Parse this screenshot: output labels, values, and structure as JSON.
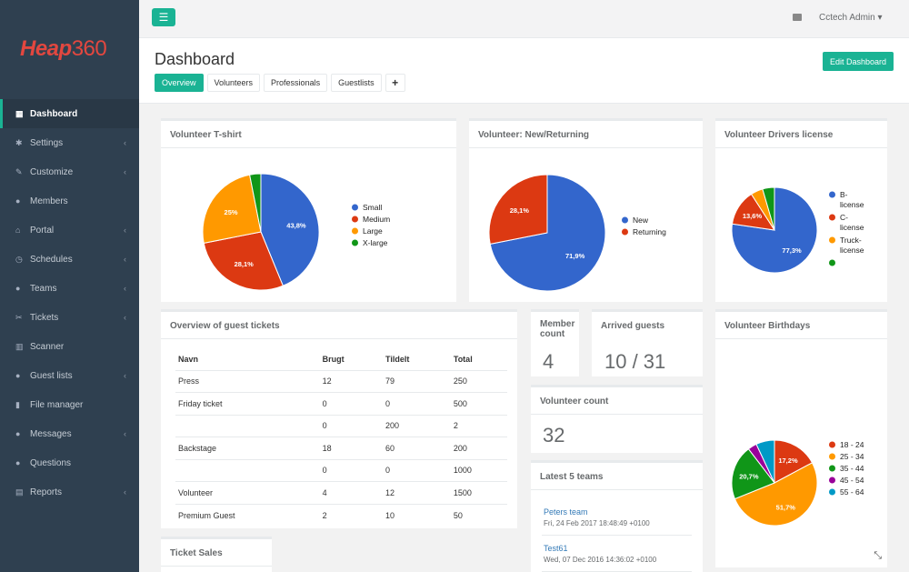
{
  "brand": {
    "logo_text": "Heap",
    "logo_num": "360"
  },
  "sidebar": {
    "items": [
      {
        "label": "Dashboard",
        "icon": "calendar-icon",
        "glyph": "▦",
        "chevron": false
      },
      {
        "label": "Settings",
        "icon": "cogs-icon",
        "glyph": "✱",
        "chevron": true
      },
      {
        "label": "Customize",
        "icon": "brush-icon",
        "glyph": "✎",
        "chevron": true
      },
      {
        "label": "Members",
        "icon": "user-icon",
        "glyph": "●",
        "chevron": false
      },
      {
        "label": "Portal",
        "icon": "home-icon",
        "glyph": "⌂",
        "chevron": true
      },
      {
        "label": "Schedules",
        "icon": "clock-icon",
        "glyph": "◷",
        "chevron": true
      },
      {
        "label": "Teams",
        "icon": "users-icon",
        "glyph": "●",
        "chevron": true
      },
      {
        "label": "Tickets",
        "icon": "ticket-icon",
        "glyph": "✂",
        "chevron": true
      },
      {
        "label": "Scanner",
        "icon": "barcode-icon",
        "glyph": "▥",
        "chevron": false
      },
      {
        "label": "Guest lists",
        "icon": "user-plus-icon",
        "glyph": "●",
        "chevron": true
      },
      {
        "label": "File manager",
        "icon": "file-icon",
        "glyph": "▮",
        "chevron": false
      },
      {
        "label": "Messages",
        "icon": "comments-icon",
        "glyph": "●",
        "chevron": true
      },
      {
        "label": "Questions",
        "icon": "user-plus-icon",
        "glyph": "●",
        "chevron": false
      },
      {
        "label": "Reports",
        "icon": "table-icon",
        "glyph": "▤",
        "chevron": true
      }
    ]
  },
  "topbar": {
    "menu_glyph": "☰",
    "user": "Cctech Admin ▾"
  },
  "header": {
    "title": "Dashboard",
    "tabs": [
      "Overview",
      "Volunteers",
      "Professionals",
      "Guestlists"
    ],
    "plus": "+",
    "edit_button": "Edit Dashboard"
  },
  "panels": {
    "tshirt": {
      "title": "Volunteer T-shirt"
    },
    "newret": {
      "title": "Volunteer: New/Returning"
    },
    "license": {
      "title": "Volunteer Drivers license"
    },
    "guest_tickets": {
      "title": "Overview of guest tickets",
      "columns": [
        "Navn",
        "Brugt",
        "Tildelt",
        "Total"
      ],
      "rows": [
        [
          "Press",
          "12",
          "79",
          "250"
        ],
        [
          "Friday ticket",
          "0",
          "0",
          "500"
        ],
        [
          "",
          "0",
          "200",
          "2"
        ],
        [
          "Backstage",
          "18",
          "60",
          "200"
        ],
        [
          "",
          "0",
          "0",
          "1000"
        ],
        [
          "Volunteer",
          "4",
          "12",
          "1500"
        ],
        [
          "Premium Guest",
          "2",
          "10",
          "50"
        ]
      ]
    },
    "member_count": {
      "title": "Member count",
      "value": "4"
    },
    "arrived": {
      "title": "Arrived guests",
      "value": "10 / 31"
    },
    "volunteer_count": {
      "title": "Volunteer count",
      "value": "32"
    },
    "teams": {
      "title": "Latest 5 teams",
      "items": [
        {
          "name": "Peters team",
          "time": "Fri, 24 Feb 2017 18:48:49 +0100"
        },
        {
          "name": "Test61",
          "time": "Wed, 07 Dec 2016 14:36:02 +0100"
        }
      ]
    },
    "birthdays": {
      "title": "Volunteer Birthdays"
    },
    "ticket_sales": {
      "title": "Ticket Sales"
    }
  },
  "chart_data": [
    {
      "type": "pie",
      "title": "Volunteer T-shirt",
      "categories": [
        "Small",
        "Medium",
        "Large",
        "X-large"
      ],
      "values": [
        43.8,
        28.1,
        25,
        3.1
      ],
      "labels": [
        "43,8%",
        "28,1%",
        "25%",
        ""
      ],
      "colors": [
        "#3366cc",
        "#dc3912",
        "#ff9900",
        "#109618"
      ]
    },
    {
      "type": "pie",
      "title": "Volunteer: New/Returning",
      "categories": [
        "New",
        "Returning"
      ],
      "values": [
        71.9,
        28.1
      ],
      "labels": [
        "71,9%",
        "28,1%"
      ],
      "colors": [
        "#3366cc",
        "#dc3912"
      ]
    },
    {
      "type": "pie",
      "title": "Volunteer Drivers license",
      "categories": [
        "B-license",
        "C-license",
        "Truck-license",
        ""
      ],
      "values": [
        77.3,
        13.6,
        4.6,
        4.5
      ],
      "labels": [
        "77,3%",
        "13,6%",
        "",
        ""
      ],
      "colors": [
        "#3366cc",
        "#dc3912",
        "#ff9900",
        "#109618"
      ]
    },
    {
      "type": "pie",
      "title": "Volunteer Birthdays",
      "categories": [
        "18 - 24",
        "25 - 34",
        "35 - 44",
        "45 - 54",
        "55 - 64"
      ],
      "values": [
        17.2,
        51.7,
        20.7,
        3.4,
        7.0
      ],
      "labels": [
        "17,2%",
        "51,7%",
        "20,7%",
        "",
        ""
      ],
      "colors": [
        "#dc3912",
        "#ff9900",
        "#109618",
        "#990099",
        "#0099c6"
      ]
    }
  ]
}
